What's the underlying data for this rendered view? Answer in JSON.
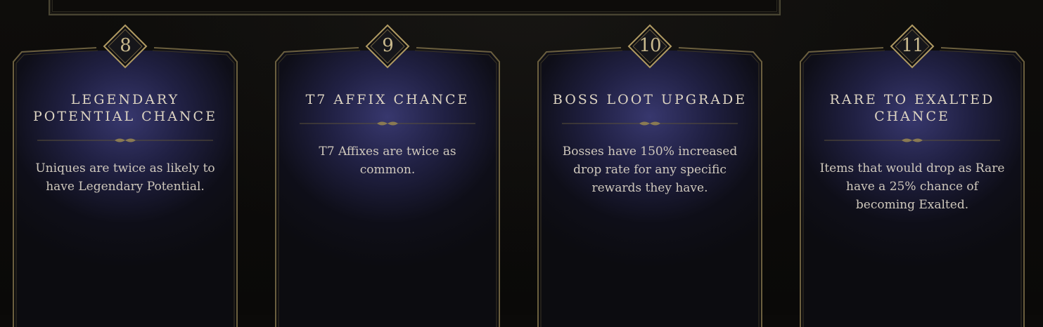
{
  "cards": [
    {
      "number": "8",
      "title": "Legendary Potential Chance",
      "description": "Uniques are twice as likely to have Legendary Potential."
    },
    {
      "number": "9",
      "title": "T7 Affix Chance",
      "description": "T7 Affixes are twice as common."
    },
    {
      "number": "10",
      "title": "Boss Loot Upgrade",
      "description": "Bosses have 150% increased drop rate for any specific rewards they have."
    },
    {
      "number": "11",
      "title": "Rare to Exalted Chance",
      "description": "Items that would drop as Rare have a 25% chance of becoming Exalted."
    }
  ],
  "colors": {
    "gold": "#c9b98d",
    "card_glow": "#3a3a73",
    "text": "#cfc8bc"
  }
}
